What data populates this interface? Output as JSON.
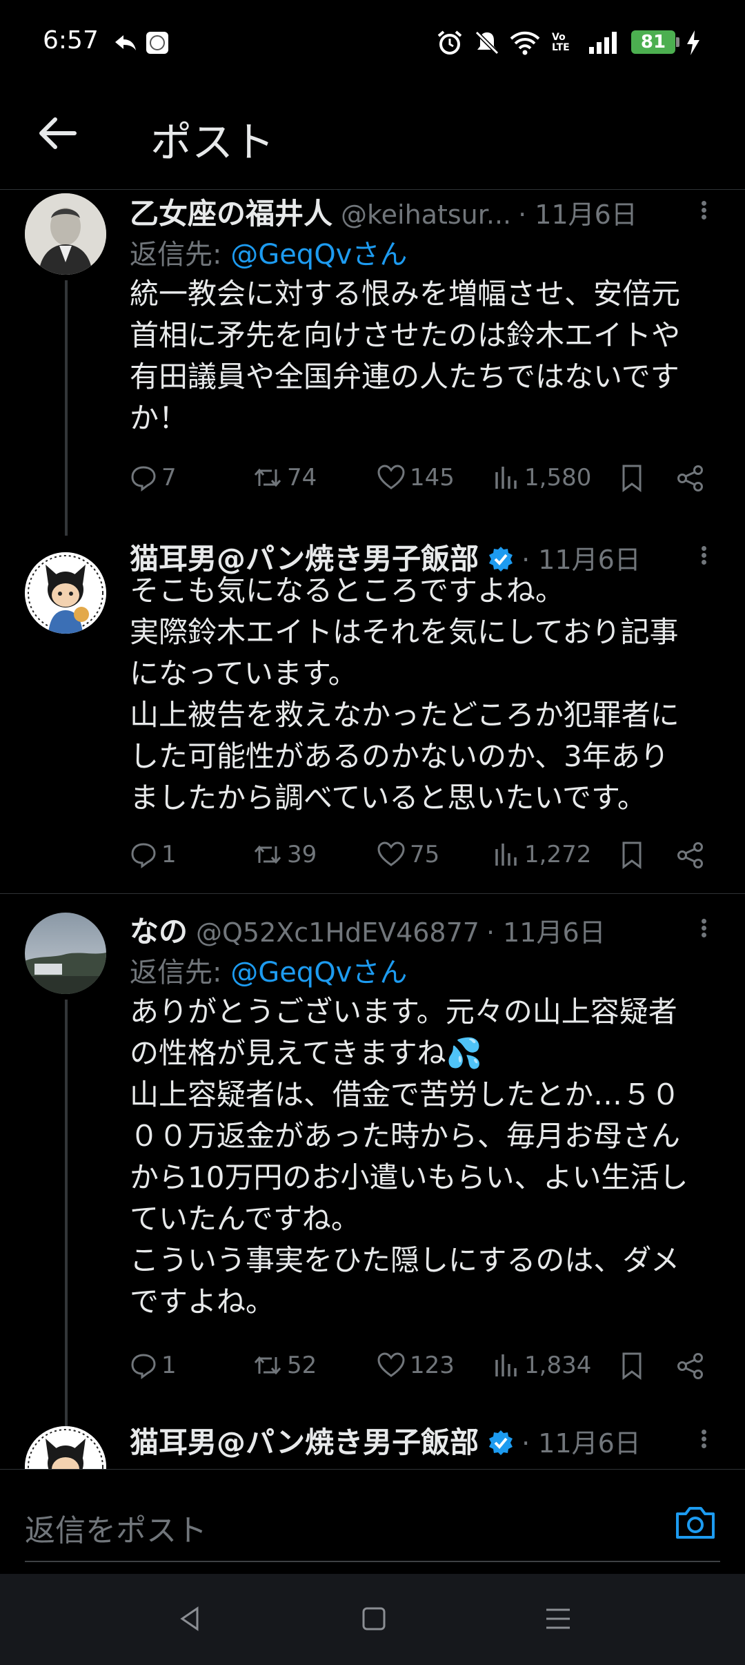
{
  "status_bar": {
    "time": "6:57",
    "battery": "81",
    "lte": "Vo LTE"
  },
  "header": {
    "title": "ポスト"
  },
  "tweets": [
    {
      "name": "乙女座の福井人",
      "handle": "@keihatsur...",
      "date": "· 11月6日",
      "reply_label": "返信先: ",
      "reply_mention": "@GeqQvさん",
      "lines": [
        "統一教会に対する恨みを増幅させ、安倍元",
        "首相に矛先を向けさせたのは鈴木エイトや",
        "有田議員や全国弁連の人たちではないです",
        "か！"
      ],
      "replies": "7",
      "reposts": "74",
      "likes": "145",
      "views": "1,580"
    },
    {
      "name": "猫耳男@パン焼き男子飯部",
      "handle": "",
      "date": "· 11月6日",
      "lines": [
        "そこも気になるところですよね。",
        "実際鈴木エイトはそれを気にしており記事",
        "になっています。",
        "山上被告を救えなかったどころか犯罪者に",
        "した可能性があるのかないのか、3年あり",
        "ましたから調べていると思いたいです。"
      ],
      "replies": "1",
      "reposts": "39",
      "likes": "75",
      "views": "1,272"
    },
    {
      "name": "なの",
      "handle": "@Q52Xc1HdEV46877",
      "date": "· 11月6日",
      "reply_label": "返信先: ",
      "reply_mention": "@GeqQvさん",
      "lines": [
        "ありがとうございます。元々の山上容疑者",
        "の性格が見えてきますね💦",
        "山上容疑者は、借金で苦労したとか…５０",
        "００万返金があった時から、毎月お母さん",
        "から10万円のお小遣いもらい、よい生活し",
        "ていたんですね。",
        "こういう事実をひた隠しにするのは、ダメ",
        "ですよね。"
      ],
      "replies": "1",
      "reposts": "52",
      "likes": "123",
      "views": "1,834"
    },
    {
      "name": "猫耳男@パン焼き男子飯部",
      "date": "· 11月6日"
    }
  ],
  "compose": {
    "placeholder": "返信をポスト"
  },
  "colors": {
    "accent": "#1d9bf0",
    "muted": "#71767b",
    "text": "#e7e9ea",
    "battery": "#4caf50"
  }
}
